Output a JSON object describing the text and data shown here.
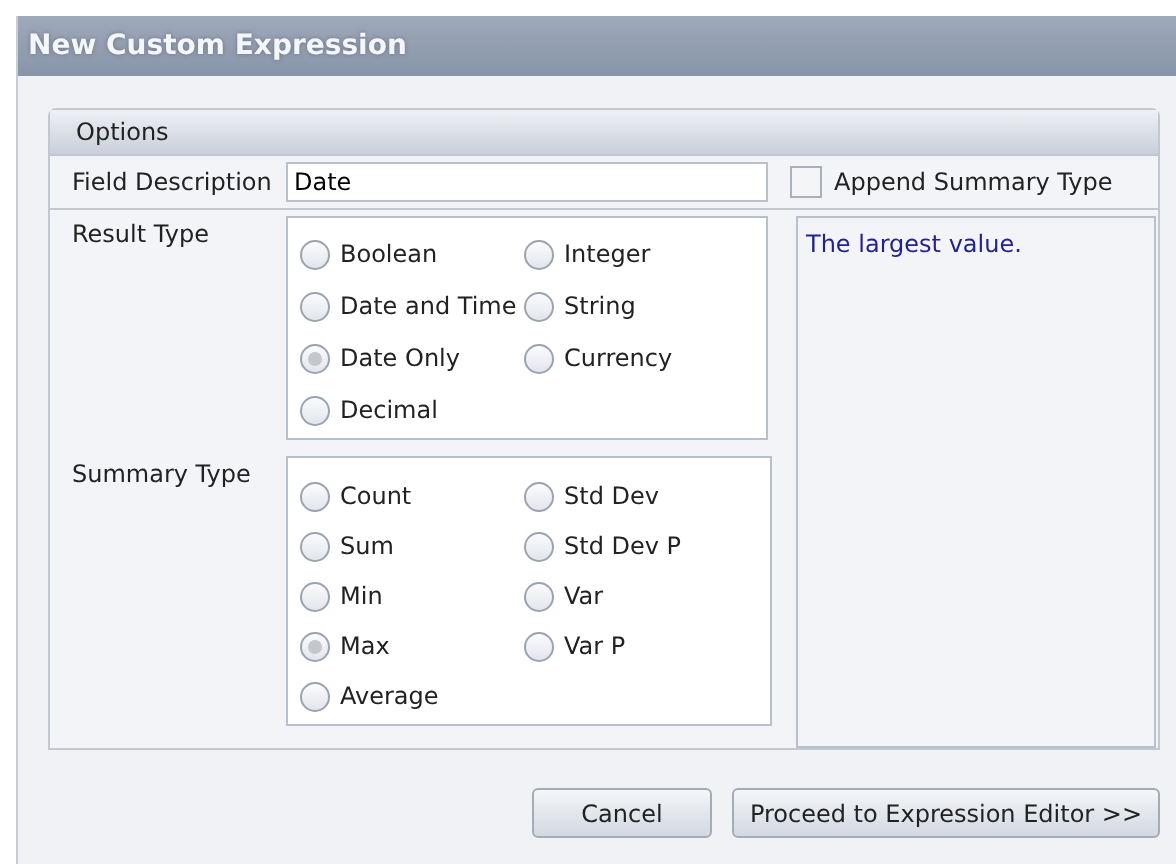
{
  "window": {
    "title": "New Custom Expression"
  },
  "panel": {
    "title": "Options"
  },
  "field_description": {
    "label": "Field Description",
    "value": "Date"
  },
  "append_summary_type": {
    "label": "Append Summary Type",
    "checked": false
  },
  "result_type": {
    "label": "Result Type",
    "options": [
      {
        "label": "Boolean",
        "selected": false
      },
      {
        "label": "Integer",
        "selected": false
      },
      {
        "label": "Date and Time",
        "selected": false
      },
      {
        "label": "String",
        "selected": false
      },
      {
        "label": "Date Only",
        "selected": true
      },
      {
        "label": "Currency",
        "selected": false
      },
      {
        "label": "Decimal",
        "selected": false
      }
    ]
  },
  "summary_type": {
    "label": "Summary Type",
    "options": [
      {
        "label": "Count",
        "selected": false
      },
      {
        "label": "Std Dev",
        "selected": false
      },
      {
        "label": "Sum",
        "selected": false
      },
      {
        "label": "Std Dev P",
        "selected": false
      },
      {
        "label": "Min",
        "selected": false
      },
      {
        "label": "Var",
        "selected": false
      },
      {
        "label": "Max",
        "selected": true
      },
      {
        "label": "Var P",
        "selected": false
      },
      {
        "label": "Average",
        "selected": false
      }
    ]
  },
  "description": "The largest value.",
  "buttons": [
    "Cancel",
    "Proceed to Expression Editor >>"
  ]
}
